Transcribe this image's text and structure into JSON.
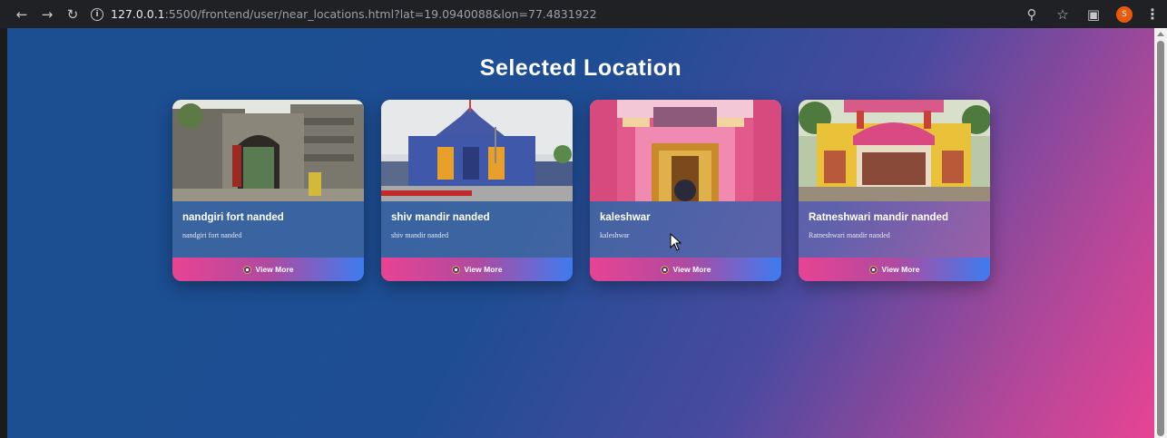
{
  "browser": {
    "back_icon": "arrow-left-icon",
    "forward_icon": "arrow-right-icon",
    "reload_icon": "reload-icon",
    "url_host": "127.0.0.1",
    "url_rest": ":5500/frontend/user/near_locations.html?lat=19.0940088&lon=77.4831922",
    "profile_initial": "S"
  },
  "page": {
    "title": "Selected Location"
  },
  "cards": [
    {
      "title": "nandgiri fort nanded",
      "description": "nandgiri fort nanded",
      "button": "View More",
      "image": "fort-gate-photo"
    },
    {
      "title": "shiv mandir nanded",
      "description": "shiv mandir nanded",
      "button": "View More",
      "image": "blue-temple-photo"
    },
    {
      "title": "kaleshwar",
      "description": "kaleshwar",
      "button": "View More",
      "image": "pink-shrine-photo"
    },
    {
      "title": "Ratneshwari mandir nanded",
      "description": "Ratneshwari mandir nanded",
      "button": "View More",
      "image": "ratneshwari-temple-photo"
    }
  ],
  "colors": {
    "background_start": "#1b4f92",
    "background_end": "#e84393",
    "button_start": "#e84393",
    "button_end": "#3d7cf0"
  }
}
